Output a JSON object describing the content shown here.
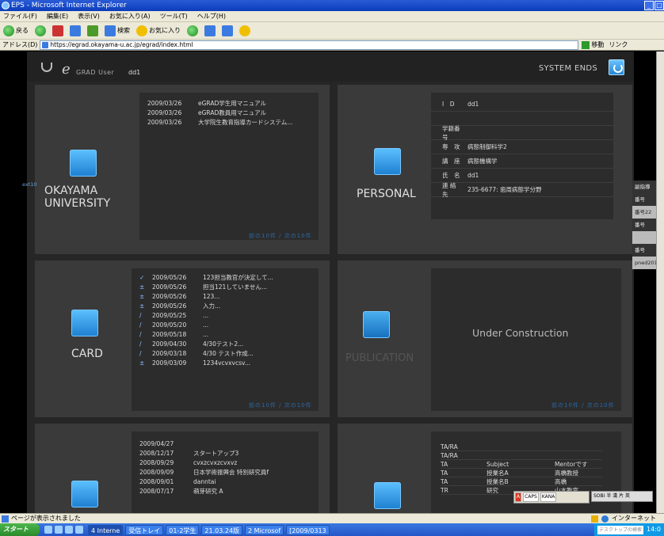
{
  "window": {
    "title": "EPS - Microsoft Internet Explorer"
  },
  "menubar": {
    "items": [
      "ファイル(F)",
      "編集(E)",
      "表示(V)",
      "お気に入り(A)",
      "ツール(T)",
      "ヘルプ(H)"
    ]
  },
  "toolbar": {
    "back": "戻る",
    "search": "検索",
    "favorites": "お気に入り"
  },
  "address": {
    "label": "アドレス(D)",
    "url": "https://egrad.okayama-u.ac.jp/egrad/index.html",
    "go": "移動",
    "links": "リンク"
  },
  "header": {
    "logo_text": "GRAD User",
    "user": "dd1",
    "system_ends": "SYSTEM ENDS"
  },
  "panels": {
    "university": {
      "label_line1": "OKAYAMA",
      "label_line2": "UNIVERSITY",
      "side_tag": "ext10",
      "pager": "前の10件 / 次の10件",
      "rows": [
        {
          "date": "2009/03/26",
          "text": "eGRAD学生用マニュアル"
        },
        {
          "date": "2009/03/26",
          "text": "eGRAD教員用マニュアル"
        },
        {
          "date": "2009/03/26",
          "text": "大学院生教育指導カードシステム..."
        }
      ]
    },
    "personal": {
      "label": "PERSONAL",
      "rows": [
        {
          "k": "I　D",
          "v": "dd1"
        },
        {
          "k": "",
          "v": ""
        },
        {
          "k": "学籍番号",
          "v": ""
        },
        {
          "k": "専　攻",
          "v": "病態制御科学2"
        },
        {
          "k": "講　座",
          "v": "病態機構学"
        },
        {
          "k": "氏　名",
          "v": "dd1"
        },
        {
          "k": "連 絡 先",
          "v": "235-6677: 歯周病態学分野"
        }
      ]
    },
    "card": {
      "label": "CARD",
      "pager": "前の10件 / 次の10件",
      "rows": [
        {
          "mark": "✓",
          "date": "2009/05/26",
          "text": "123担当教官が決定して..."
        },
        {
          "mark": "±",
          "date": "2009/05/26",
          "text": "担当121していません..."
        },
        {
          "mark": "±",
          "date": "2009/05/26",
          "text": "123..."
        },
        {
          "mark": "±",
          "date": "2009/05/26",
          "text": "入力..."
        },
        {
          "mark": "/",
          "date": "2009/05/25",
          "text": "..."
        },
        {
          "mark": "/",
          "date": "2009/05/20",
          "text": "..."
        },
        {
          "mark": "/",
          "date": "2009/05/18",
          "text": "..."
        },
        {
          "mark": "/",
          "date": "2009/04/30",
          "text": "4/30テスト2..."
        },
        {
          "mark": "/",
          "date": "2009/03/18",
          "text": "4/30 テスト作成..."
        },
        {
          "mark": "±",
          "date": "2009/03/09",
          "text": "1234vcvxvcsv..."
        }
      ]
    },
    "publication": {
      "label": "PUBLICATION",
      "message": "Under Construction",
      "pager": "前の10件 / 次の10件"
    },
    "bottom_left": {
      "rows": [
        {
          "date": "2009/04/27",
          "text": ""
        },
        {
          "date": "2008/12/17",
          "text": "スタートアップ3"
        },
        {
          "date": "2008/09/29",
          "text": "cvxzcvxzcvxvz"
        },
        {
          "date": "2008/09/09",
          "text": "日本学術振興会 特別研究員f"
        },
        {
          "date": "2008/09/01",
          "text": "danntai"
        },
        {
          "date": "2008/07/17",
          "text": "萌芽研究 A"
        }
      ]
    },
    "bottom_right": {
      "rows": [
        {
          "c1": "TA/RA",
          "c2": "",
          "c3": ""
        },
        {
          "c1": "TA/RA",
          "c2": "",
          "c3": ""
        },
        {
          "c1": "TA",
          "c2": "Subject",
          "c3": "Mentorです"
        },
        {
          "c1": "TA",
          "c2": "授業名A",
          "c3": "高橋教授"
        },
        {
          "c1": "TA",
          "c2": "授業名B",
          "c3": "高橋"
        },
        {
          "c1": "TR",
          "c2": "研究",
          "c3": "山本教室"
        }
      ]
    },
    "side_tabs": [
      "副指導",
      "番号",
      "番号22",
      "番号",
      "",
      "番号",
      "pned201"
    ]
  },
  "statusbar": {
    "text": "ページが表示されました",
    "zone": "インターネット"
  },
  "taskbar": {
    "start": "スタート",
    "items": [
      "4 Interne",
      "受信トレイ",
      "01-2学生",
      "21.03.24版",
      "2 Microsof",
      "[2009/0313"
    ],
    "search": "デスクトップの検索",
    "clock": "14:0"
  },
  "ime": {
    "labels": [
      "A",
      "CAPS",
      "KANA"
    ],
    "ext": "SOBI 半 漢 片 英"
  }
}
